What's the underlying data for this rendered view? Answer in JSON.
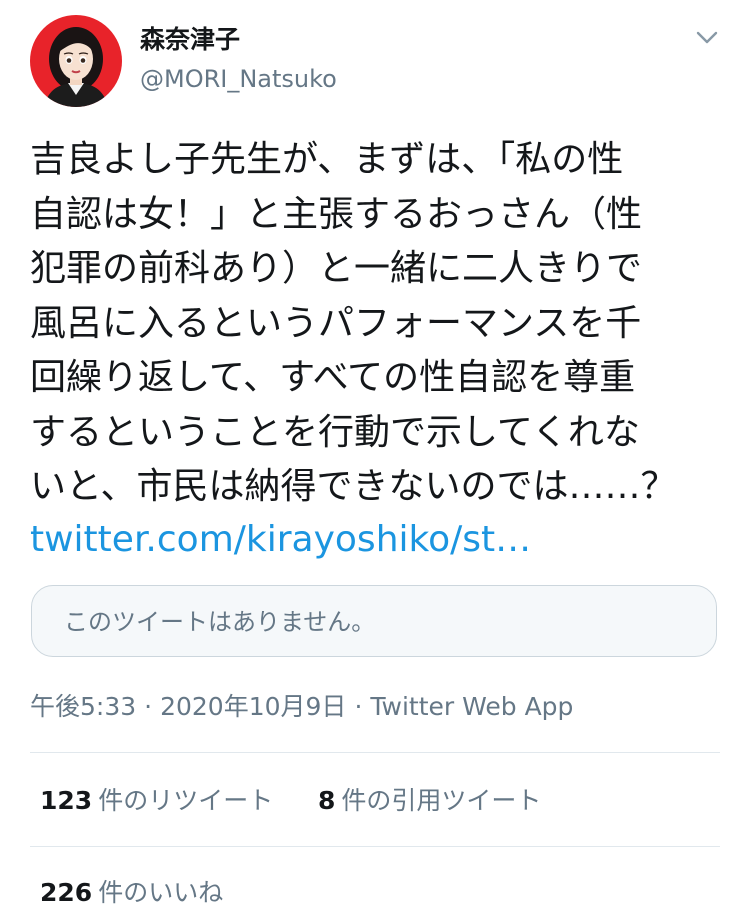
{
  "user": {
    "display_name": "森奈津子",
    "handle": "@MORI_Natsuko"
  },
  "tweet": {
    "text_lines": [
      "吉良よし子先生が、まずは、「私の性",
      "自認は女！」と主張するおっさん（性",
      "犯罪の前科あり）と一緒に二人きりで",
      "風呂に入るというパフォーマンスを千",
      "回繰り返して、すべての性自認を尊重",
      "するということを行動で示してくれな",
      "いと、市民は納得できないのでは……？"
    ],
    "link": "twitter.com/kirayoshiko/st…"
  },
  "quote": {
    "unavailable_text": "このツイートはありません。"
  },
  "meta": {
    "time": "午後5:33",
    "date": "2020年10月9日",
    "separator": "·",
    "source": "Twitter Web App"
  },
  "stats": {
    "retweets_count": "123",
    "retweets_label": "件のリツイート",
    "quotes_count": "8",
    "quotes_label": "件の引用ツイート",
    "likes_count": "226",
    "likes_label": "件のいいね"
  },
  "icons": {
    "more": "chevron-down-icon",
    "avatar": "avatar-illustration"
  },
  "colors": {
    "link": "#1b95e0",
    "secondary_text": "#657786",
    "primary_text": "#14171a",
    "divider": "#e1e8ed",
    "avatar_bg": "#e8232a"
  }
}
